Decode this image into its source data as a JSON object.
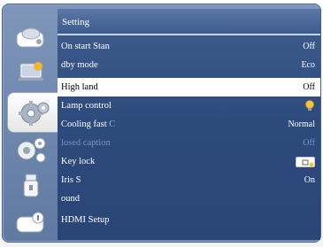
{
  "menu": {
    "title": "Setting",
    "rows": [
      {
        "label": "On start  Stan",
        "value": "Off"
      },
      {
        "label": "dby mode",
        "value": "Eco"
      },
      {
        "label": "High land",
        "value": "Off"
      },
      {
        "label": "Lamp control",
        "value": ""
      },
      {
        "label": "Cooling fast",
        "label_suffix": "C",
        "value": "Normal"
      },
      {
        "label": "losed caption",
        "value": "Off"
      },
      {
        "label": "Key lock",
        "value": ""
      },
      {
        "label": "Iris  S",
        "value": "On"
      },
      {
        "label": "ound",
        "value": ""
      },
      {
        "label": "HDMI Setup",
        "value": ""
      }
    ]
  },
  "sidebar": {
    "items": [
      {
        "icon": "display-icon"
      },
      {
        "icon": "image-adjust-icon"
      },
      {
        "icon": "gear-icon"
      },
      {
        "icon": "advanced-gear-icon"
      },
      {
        "icon": "usb-drive-icon"
      },
      {
        "icon": "info-icon"
      }
    ]
  },
  "colors": {
    "selected_row": "#ffffff",
    "menu_bg": "#2d4a7d",
    "panel_bg": "#6e87ad",
    "lamp_icon": "#f2c63a"
  }
}
